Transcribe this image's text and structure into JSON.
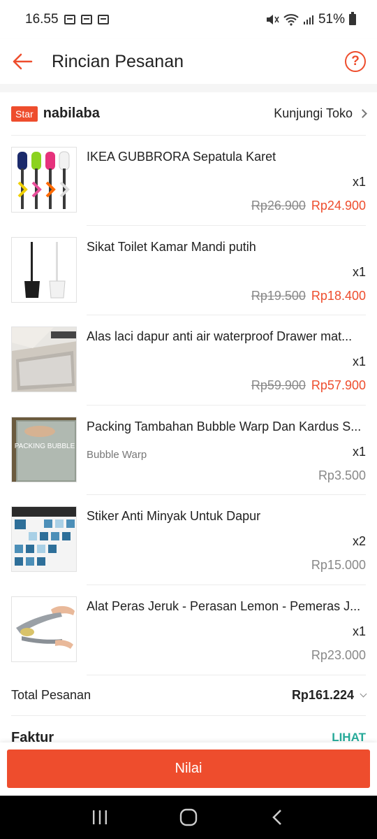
{
  "status": {
    "time": "16.55",
    "battery": "51%"
  },
  "header": {
    "title": "Rincian Pesanan"
  },
  "shop": {
    "badge": "Star",
    "name": "nabilaba",
    "visit_label": "Kunjungi Toko"
  },
  "items": [
    {
      "name": "IKEA GUBBRORA Sepatula Karet",
      "variant": "",
      "qty": "x1",
      "price_old": "Rp26.900",
      "price": "Rp24.900"
    },
    {
      "name": "Sikat Toilet Kamar Mandi putih",
      "variant": "",
      "qty": "x1",
      "price_old": "Rp19.500",
      "price": "Rp18.400"
    },
    {
      "name": "Alas laci dapur anti air waterproof Drawer mat...",
      "variant": "",
      "qty": "x1",
      "price_old": "Rp59.900",
      "price": "Rp57.900"
    },
    {
      "name": "Packing Tambahan Bubble Warp Dan Kardus S...",
      "variant": "Bubble Warp",
      "qty": "x1",
      "price_old": "",
      "price": "Rp3.500",
      "thumb_text": "PACKING BUBBLE"
    },
    {
      "name": "Stiker Anti Minyak Untuk Dapur",
      "variant": "",
      "qty": "x2",
      "price_old": "",
      "price": "Rp15.000"
    },
    {
      "name": "Alat Peras Jeruk - Perasan Lemon - Pemeras J...",
      "variant": "",
      "qty": "x1",
      "price_old": "",
      "price": "Rp23.000"
    }
  ],
  "total": {
    "label": "Total Pesanan",
    "value": "Rp161.224"
  },
  "faktur": {
    "label": "Faktur",
    "link": "LIHAT"
  },
  "actions": {
    "rate_label": "Nilai"
  },
  "colors": {
    "accent": "#ee4d2d",
    "link": "#26aa99"
  }
}
